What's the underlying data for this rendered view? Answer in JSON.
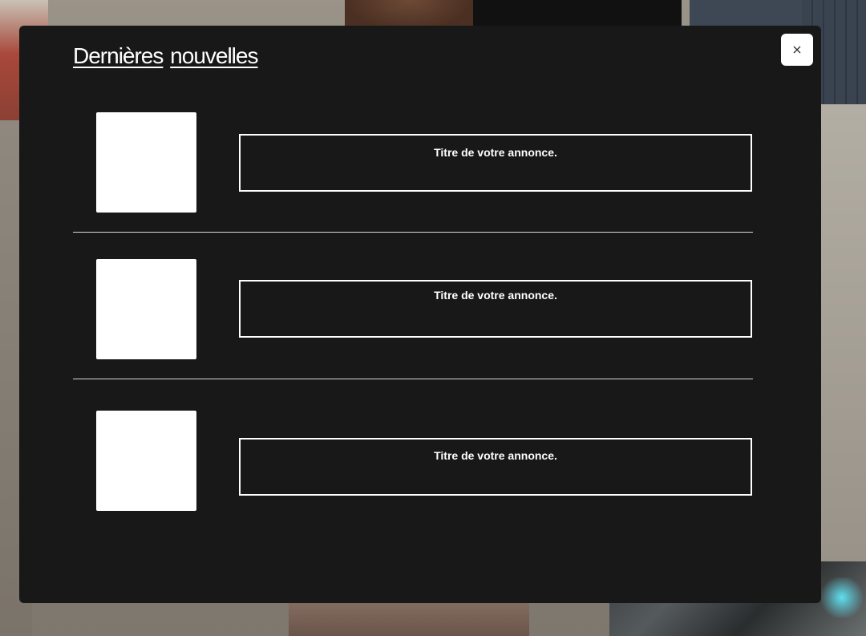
{
  "panel": {
    "title_word_1": "Dernières",
    "title_word_2": "nouvelles",
    "close_label": "×"
  },
  "news": [
    {
      "title": "Titre de votre annonce."
    },
    {
      "title": "Titre de votre annonce."
    },
    {
      "title": "Titre de votre annonce."
    }
  ],
  "colors": {
    "panel_bg": "#181818",
    "text": "#ffffff",
    "thumb": "#ffffff"
  },
  "icons": {
    "close": "close-icon"
  }
}
